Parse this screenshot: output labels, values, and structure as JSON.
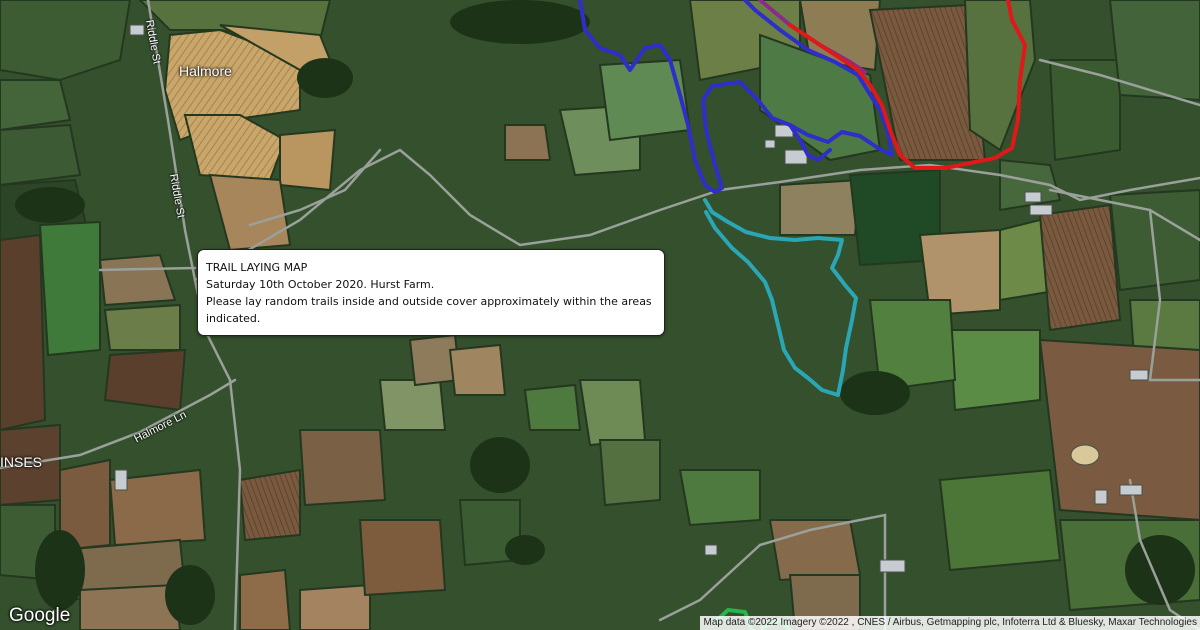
{
  "map": {
    "places": {
      "halmore": "Halmore",
      "inses": "INSES"
    },
    "roads": {
      "riddle_st": "Riddle St",
      "riddle_st_2": "Riddle St",
      "halmore_ln": "Halmore Ln"
    },
    "trail_colors": {
      "blue": "#2e2ec8",
      "red": "#e01818",
      "cyan": "#2aa6b4",
      "green": "#27b44a",
      "purple": "#8a2b8a"
    }
  },
  "info_box": {
    "title": "TRAIL LAYING MAP",
    "date_line": "Saturday 10th October 2020. Hurst Farm.",
    "instructions": "Please lay random trails inside and outside cover approximately within the areas indicated."
  },
  "footer": {
    "logo": "Google",
    "attribution": "Map data ©2022 Imagery ©2022 , CNES / Airbus, Getmapping plc, Infoterra Ltd & Bluesky, Maxar Technologies"
  }
}
